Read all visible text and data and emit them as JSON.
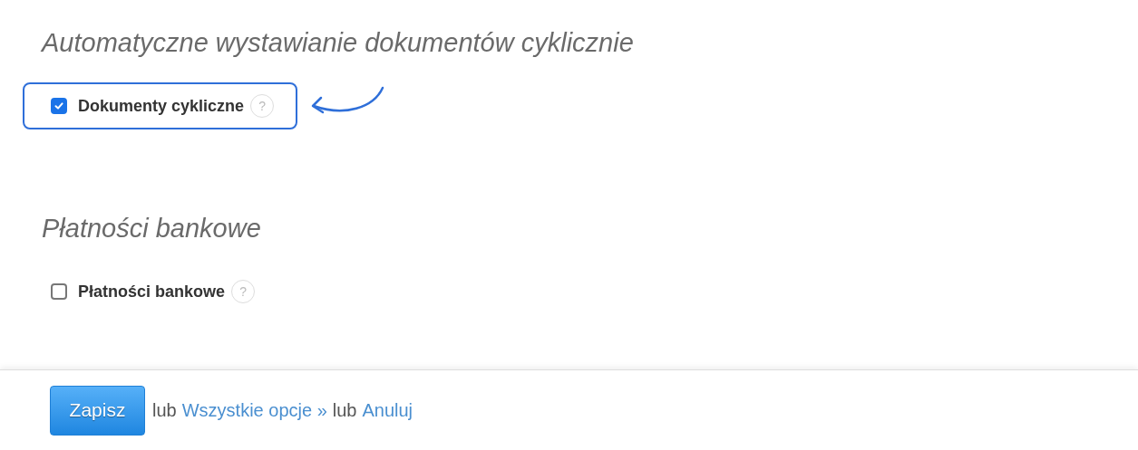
{
  "sections": [
    {
      "heading": "Automatyczne wystawianie dokumentów cyklicznie",
      "option": {
        "label": "Dokumenty cykliczne",
        "checked": true,
        "highlighted": true,
        "help": "?"
      }
    },
    {
      "heading": "Płatności bankowe",
      "option": {
        "label": "Płatności bankowe",
        "checked": false,
        "highlighted": false,
        "help": "?"
      }
    }
  ],
  "footer": {
    "save": "Zapisz",
    "or_1": "lub",
    "all_options": "Wszystkie opcje »",
    "or_2": "lub",
    "cancel": "Anuluj"
  }
}
